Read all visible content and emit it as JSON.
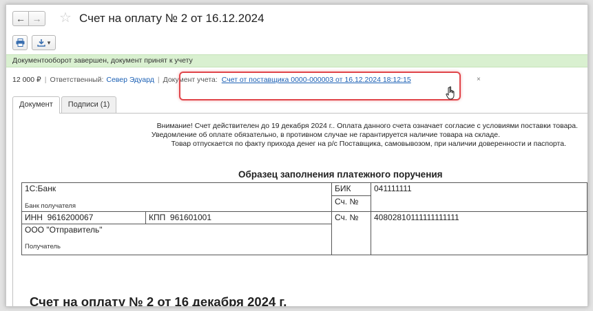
{
  "header": {
    "back_icon": "←",
    "forward_icon": "→",
    "star_icon": "☆",
    "title": "Счет на оплату № 2 от 16.12.2024"
  },
  "toolbar": {
    "print_icon": "printer-icon",
    "save_icon": "download-icon",
    "dropdown_glyph": "▾"
  },
  "status": {
    "text": "Документооборот завершен, документ принят к учету"
  },
  "info": {
    "amount": "12 000 ₽",
    "responsible_label": "Ответственный:",
    "responsible_value": "Север Эдуард",
    "accounting_doc_label": "Документ учета:",
    "accounting_doc_link": "Счет от поставщика 0000-000003 от 16.12.2024 18:12:15",
    "close_glyph": "×"
  },
  "tabs": [
    {
      "label": "Документ",
      "active": true
    },
    {
      "label": "Подписи (1)",
      "active": false
    }
  ],
  "document": {
    "notice": [
      "Внимание! Счет действителен до 19 декабря 2024 г.. Оплата данного счета означает согласие с условиями поставки товара.",
      "Уведомление об оплате обязательно, в противном случае не гарантируется наличие товара на складе.",
      "Товар отпускается по факту прихода денег на р/с Поставщика, самовывозом, при наличии доверенности и паспорта."
    ],
    "sample_title": "Образец заполнения платежного поручения",
    "bank": {
      "bank_name": "1С:Банк",
      "bank_label": "Банк получателя",
      "bik_label": "БИК",
      "bik_value": "041111111",
      "corr_label": "Сч. №",
      "inn_label": "ИНН",
      "inn_value": "9616200067",
      "kpp_label": "КПП",
      "kpp_value": "961601001",
      "acc_label": "Сч. №",
      "acc_value": "40802810111111111111",
      "recipient_name": "ООО \"Отправитель\"",
      "recipient_label": "Получатель"
    },
    "invoice_title": "Счет на оплату № 2 от 16 декабря 2024 г."
  },
  "colors": {
    "status_bg": "#d9f0d0",
    "link": "#1a5fb4",
    "highlight": "#e0454a"
  }
}
